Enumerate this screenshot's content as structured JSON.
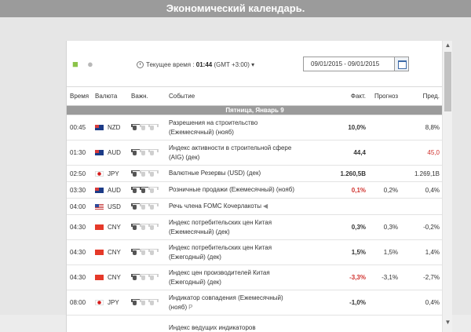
{
  "window": {
    "title": "Экономический календарь."
  },
  "toolbar": {
    "time_label": "Текущее время :",
    "time_value": "01:44",
    "timezone": "(GMT +3:00)",
    "date_range": "09/01/2015 - 09/01/2015"
  },
  "table": {
    "headers": {
      "time": "Время",
      "currency": "Валюта",
      "volatility": "Важн.",
      "event": "Событие",
      "actual": "Факт.",
      "forecast": "Прогноз",
      "previous": "Пред."
    },
    "day_header": "Пятница, Январь 9",
    "rows": [
      {
        "time": "00:45",
        "flag": "nz",
        "currency": "NZD",
        "bulls": 1,
        "event1": "Разрешения на строительство",
        "event2": "(Ежемесячный) (нояб)",
        "actual": "10,0%",
        "actual_color": "#333333",
        "forecast": "",
        "previous": "8,8%",
        "previous_color": "#333333",
        "tall": true
      },
      {
        "time": "01:30",
        "flag": "au",
        "currency": "AUD",
        "bulls": 1,
        "event1": "Индекс активности в строительной сфере",
        "event2": "(AIG) (дек)",
        "actual": "44,4",
        "actual_color": "#333333",
        "forecast": "",
        "previous": "45,0",
        "previous_color": "#d0312d",
        "tall": true
      },
      {
        "time": "02:50",
        "flag": "jp",
        "currency": "JPY",
        "bulls": 1,
        "event1": "Валютные Резервы (USD) (дек)",
        "event2": "",
        "actual": "1.260,5B",
        "actual_color": "#333333",
        "forecast": "",
        "previous": "1.269,1B",
        "previous_color": "#333333",
        "tall": false
      },
      {
        "time": "03:30",
        "flag": "au",
        "currency": "AUD",
        "bulls": 2,
        "event1": "Розничные продажи (Ежемесячный) (нояб)",
        "event2": "",
        "actual": "0,1%",
        "actual_color": "#d0312d",
        "forecast": "0,2%",
        "previous": "0,4%",
        "previous_color": "#333333",
        "tall": false
      },
      {
        "time": "04:00",
        "flag": "us",
        "currency": "USD",
        "bulls": 1,
        "event1": "Речь члена FOMC Кочерлакоты",
        "event2": "",
        "event_icon": "◀",
        "actual": "",
        "actual_color": "#333333",
        "forecast": "",
        "previous": "",
        "previous_color": "#333333",
        "tall": false
      },
      {
        "time": "04:30",
        "flag": "cn",
        "currency": "CNY",
        "bulls": 1,
        "event1": "Индекс потребительских цен Китая",
        "event2": "(Ежемесячный) (дек)",
        "actual": "0,3%",
        "actual_color": "#333333",
        "forecast": "0,3%",
        "previous": "-0,2%",
        "previous_color": "#333333",
        "tall": true
      },
      {
        "time": "04:30",
        "flag": "cn",
        "currency": "CNY",
        "bulls": 1,
        "event1": "Индекс потребительских цен Китая",
        "event2": "(Ежегодный) (дек)",
        "actual": "1,5%",
        "actual_color": "#333333",
        "forecast": "1,5%",
        "previous": "1,4%",
        "previous_color": "#333333",
        "tall": true
      },
      {
        "time": "04:30",
        "flag": "cn",
        "currency": "CNY",
        "bulls": 1,
        "event1": "Индекс цен производителей Китая",
        "event2": "(Ежегодный) (дек)",
        "actual": "-3,3%",
        "actual_color": "#d0312d",
        "forecast": "-3,1%",
        "previous": "-2,7%",
        "previous_color": "#333333",
        "tall": true
      },
      {
        "time": "08:00",
        "flag": "jp",
        "currency": "JPY",
        "bulls": 1,
        "event1": "Индикатор совпадения (Ежемесячный)",
        "event2": "(нояб)",
        "event_icon": "P",
        "actual": "-1,0%",
        "actual_color": "#333333",
        "forecast": "",
        "previous": "0,4%",
        "previous_color": "#333333",
        "tall": true
      },
      {
        "time": "",
        "flag": "",
        "currency": "",
        "bulls": 0,
        "event1": "Индекс ведущих индикаторов",
        "event2": "",
        "actual": "",
        "actual_color": "#333333",
        "forecast": "",
        "previous": "",
        "previous_color": "#333333",
        "tall": true
      }
    ]
  },
  "colors": {
    "title_bar": "#9b9b9b",
    "negative": "#d0312d",
    "day_bar": "#9b9b9b"
  },
  "icons": {
    "android": "android-icon",
    "apple": "apple-icon",
    "clock": "clock-icon",
    "calendar": "calendar-icon",
    "bull": "bull-icon"
  }
}
